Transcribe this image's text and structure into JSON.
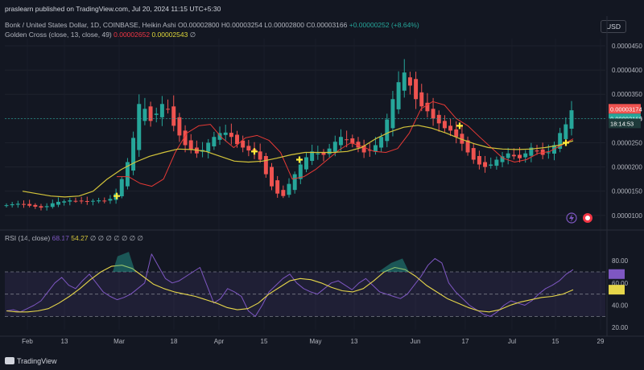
{
  "header": {
    "text": "praslearn published on TradingView.com, Jul 20, 2024 11:15 UTC+5:30"
  },
  "legend": {
    "symbol": "Bonk / United States Dollar, 1D, COINBASE, Heikin Ashi",
    "o": "O0.00002800",
    "h": "H0.00003254",
    "l": "L0.00002800",
    "c": "C0.00003166",
    "change": "+0.00000252 (+8.64%)",
    "gc_label": "Golden Cross (close, 13, close, 49)",
    "gc_v1": "0.00002652",
    "gc_v2": "0.00002543",
    "gc_suffix": "∅"
  },
  "rsi_legend": {
    "label": "RSI (14, close)",
    "v1": "68.17",
    "v2": "54.27",
    "suffix": "∅ ∅ ∅ ∅ ∅ ∅ ∅"
  },
  "currency_button": "USD",
  "footer": {
    "brand": "TradingView"
  },
  "colors": {
    "bull": "#26a69a",
    "bear": "#ef5350",
    "fast_ma": "#e53935",
    "slow_ma": "#d4c43a",
    "rsi": "#7e57c2",
    "rsi_ma": "#e6d64a",
    "background": "#131722"
  },
  "chart_data": [
    {
      "type": "candlestick",
      "title": "Bonk / United States Dollar, 1D, COINBASE, Heikin Ashi",
      "x_tick_labels": [
        "Feb",
        "13",
        "Mar",
        "18",
        "Apr",
        "15",
        "May",
        "13",
        "Jun",
        "17",
        "Jul",
        "15",
        "29"
      ],
      "y_tick_labels": [
        "0.0000450",
        "0.0000400",
        "0.0000350",
        "0.0000300",
        "0.0000250",
        "0.0000200",
        "0.0000150",
        "0.0000100"
      ],
      "ylim": [
        8.3e-06,
        4.65e-05
      ],
      "close_series": [
        1.21e-05,
        1.23e-05,
        1.24e-05,
        1.23e-05,
        1.2e-05,
        1.18e-05,
        1.16e-05,
        1.19e-05,
        1.25e-05,
        1.28e-05,
        1.29e-05,
        1.31e-05,
        1.3e-05,
        1.29e-05,
        1.28e-05,
        1.3e-05,
        1.31e-05,
        1.3e-05,
        1.34e-05,
        1.45e-05,
        1.75e-05,
        2.1e-05,
        2.6e-05,
        3.3e-05,
        3.2e-05,
        2.95e-05,
        3.1e-05,
        3.3e-05,
        3.2e-05,
        2.85e-05,
        2.65e-05,
        2.45e-05,
        2.35e-05,
        2.28e-05,
        2.35e-05,
        2.5e-05,
        2.62e-05,
        2.7e-05,
        2.71e-05,
        2.62e-05,
        2.47e-05,
        2.4e-05,
        2.34e-05,
        2.3e-05,
        2.15e-05,
        1.85e-05,
        1.6e-05,
        1.45e-05,
        1.4e-05,
        1.65e-05,
        1.85e-05,
        2.05e-05,
        2.2e-05,
        2.32e-05,
        2.28e-05,
        2.25e-05,
        2.38e-05,
        2.52e-05,
        2.62e-05,
        2.56e-05,
        2.48e-05,
        2.4e-05,
        2.3e-05,
        2.35e-05,
        2.45e-05,
        2.62e-05,
        2.98e-05,
        3.4e-05,
        3.75e-05,
        3.95e-05,
        3.68e-05,
        3.4e-05,
        3.25e-05,
        3.15e-05,
        3e-05,
        2.9e-05,
        2.8e-05,
        2.75e-05,
        2.62e-05,
        2.48e-05,
        2.3e-05,
        2.15e-05,
        2.05e-05,
        2e-05,
        2.05e-05,
        2.15e-05,
        2.22e-05,
        2.28e-05,
        2.22e-05,
        2.18e-05,
        2.28e-05,
        2.4e-05,
        2.32e-05,
        2.25e-05,
        2.3e-05,
        2.45e-05,
        2.7e-05,
        2.88e-05,
        3.17e-05
      ],
      "series": [
        {
          "name": "Golden Cross fast (13)",
          "values": [
            1.8e-05,
            1.8e-05,
            1.66e-05,
            1.6e-05,
            1.75e-05,
            2.3e-05,
            2.7e-05,
            2.85e-05,
            2.88e-05,
            2.6e-05,
            2.4e-05,
            2.6e-05,
            2.65e-05,
            2.55e-05,
            2.3e-05,
            1.75e-05,
            1.8e-05,
            1.95e-05,
            2.15e-05,
            2.35e-05,
            2.5e-05,
            2.42e-05,
            2.32e-05,
            2.3e-05,
            2.38e-05,
            2.7e-05,
            3.2e-05,
            3.35e-05,
            3.28e-05,
            3e-05,
            2.85e-05,
            2.62e-05,
            2.4e-05,
            2.18e-05,
            2.1e-05,
            2.15e-05,
            2.28e-05,
            2.32e-05,
            2.45e-05,
            2.58e-05
          ]
        },
        {
          "name": "Golden Cross slow (49)",
          "values": [
            1.5e-05,
            1.45e-05,
            1.4e-05,
            1.38e-05,
            1.4e-05,
            1.5e-05,
            1.75e-05,
            1.95e-05,
            2.1e-05,
            2.22e-05,
            2.3e-05,
            2.37e-05,
            2.36e-05,
            2.32e-05,
            2.22e-05,
            2.12e-05,
            2.1e-05,
            2.12e-05,
            2.18e-05,
            2.25e-05,
            2.3e-05,
            2.3e-05,
            2.3e-05,
            2.32e-05,
            2.4e-05,
            2.58e-05,
            2.72e-05,
            2.82e-05,
            2.86e-05,
            2.8e-05,
            2.7e-05,
            2.58e-05,
            2.48e-05,
            2.4e-05,
            2.37e-05,
            2.36e-05,
            2.37e-05,
            2.4e-05,
            2.45e-05,
            2.54e-05
          ]
        }
      ],
      "price_labels": [
        "0.00003174",
        "0.00003166",
        "18:14:53"
      ]
    },
    {
      "type": "line",
      "title": "RSI (14, close)",
      "y_tick_labels": [
        "80.00",
        "60.00",
        "40.00",
        "20.00"
      ],
      "ylim": [
        18,
        96
      ],
      "bands": [
        30,
        70
      ],
      "series": [
        {
          "name": "RSI",
          "values": [
            35,
            36,
            34,
            37,
            40,
            44,
            52,
            60,
            65,
            58,
            55,
            62,
            68,
            60,
            52,
            48,
            45,
            47,
            50,
            55,
            60,
            86,
            75,
            64,
            60,
            62,
            66,
            70,
            74,
            58,
            42,
            46,
            55,
            52,
            48,
            35,
            30,
            40,
            52,
            58,
            64,
            68,
            60,
            55,
            52,
            50,
            55,
            60,
            62,
            58,
            54,
            60,
            64,
            58,
            52,
            50,
            48,
            46,
            50,
            58,
            66,
            76,
            82,
            78,
            60,
            52,
            46,
            40,
            36,
            32,
            30,
            34,
            40,
            44,
            42,
            40,
            44,
            50,
            55,
            58,
            62,
            68,
            72
          ]
        },
        {
          "name": "RSI MA",
          "values": [
            35,
            34,
            34,
            35,
            37,
            42,
            48,
            55,
            63,
            70,
            75,
            76,
            73,
            66,
            59,
            55,
            52,
            50,
            48,
            45,
            42,
            38,
            36,
            37,
            42,
            50,
            56,
            62,
            64,
            63,
            60,
            56,
            53,
            52,
            55,
            62,
            70,
            74,
            72,
            66,
            58,
            52,
            46,
            42,
            38,
            35,
            34,
            36,
            40,
            43,
            45,
            47,
            48,
            50,
            54
          ]
        }
      ]
    }
  ]
}
